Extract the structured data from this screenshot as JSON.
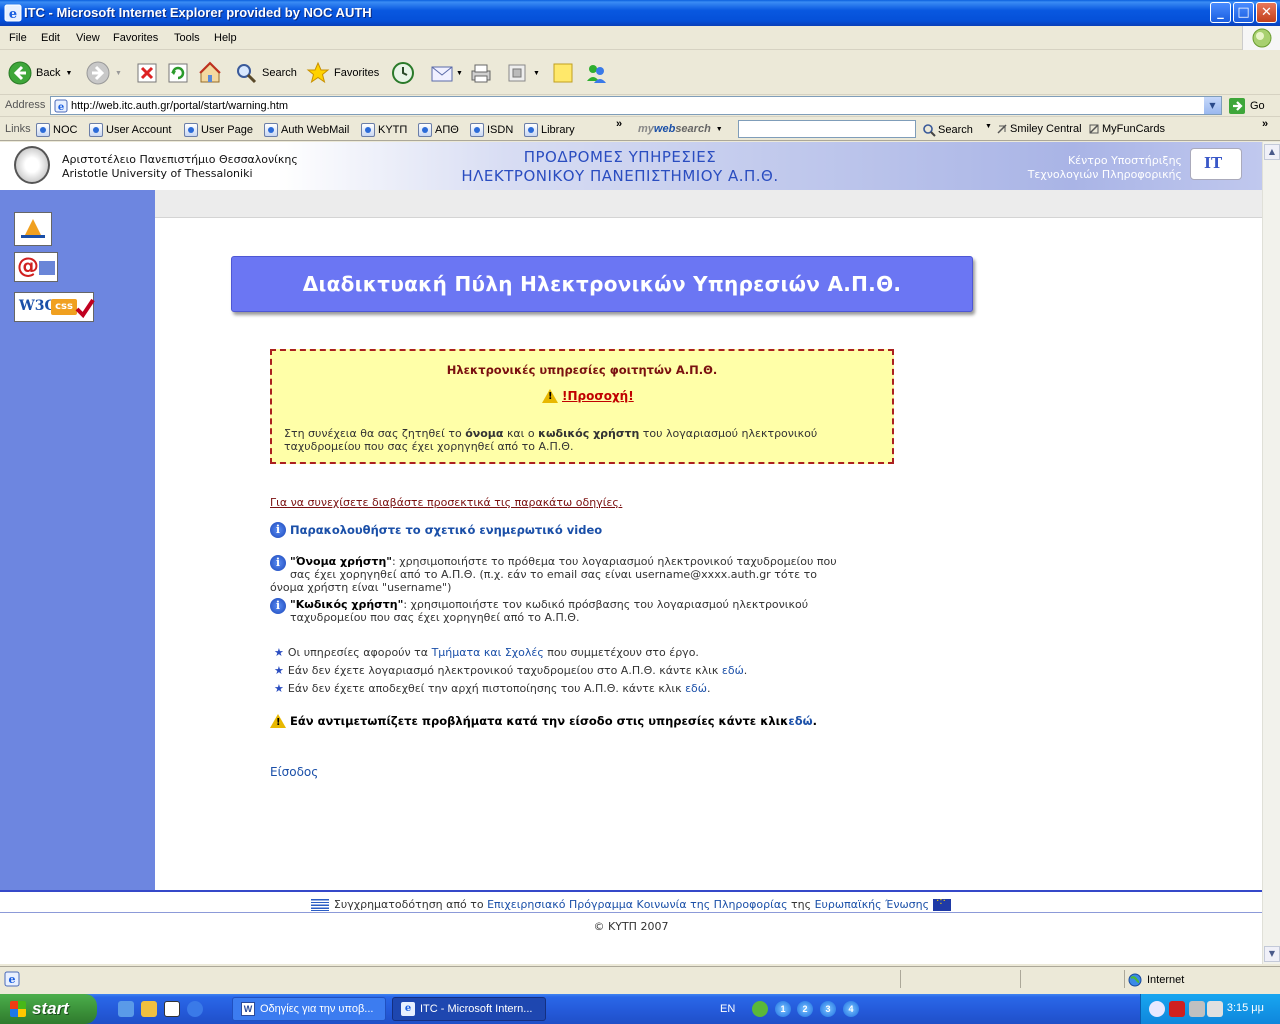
{
  "window": {
    "title": "ITC - Microsoft Internet Explorer provided by NOC  AUTH",
    "controls": {
      "minimize": "_",
      "maximize": "□",
      "close": "✕"
    }
  },
  "menu": [
    "File",
    "Edit",
    "View",
    "Favorites",
    "Tools",
    "Help"
  ],
  "toolbar": {
    "back": "Back",
    "search": "Search",
    "favorites": "Favorites"
  },
  "address": {
    "label": "Address",
    "url": "http://web.itc.auth.gr/portal/start/warning.htm",
    "go": "Go"
  },
  "links": {
    "label": "Links",
    "items": [
      "NOC",
      "User Account",
      "User Page",
      "Auth WebMail",
      "ΚΥΤΠ",
      "ΑΠΘ",
      "ISDN",
      "Library"
    ],
    "chevron": "»",
    "mywebsearch_my": "my",
    "mywebsearch_web": "web",
    "mywebsearch_search": "search",
    "search_value": "",
    "search_button": "Search",
    "smiley": "Smiley Central",
    "myfuncards": "MyFunCards"
  },
  "header": {
    "univ_gr": "Αριστοτέλειο Πανεπιστήμιο Θεσσαλονίκης",
    "univ_en": "Aristotle University of Thessaloniki",
    "title_line1": "ΠΡΟΔΡΟΜΕΣ ΥΠΗΡΕΣΙΕΣ",
    "title_line2": "ΗΛΕΚΤΡΟΝΙΚΟΥ ΠΑΝΕΠΙΣΤΗΜΙΟΥ Α.Π.Θ.",
    "itc_line1": "Κέντρο Υποστήριξης",
    "itc_line2": "Τεχνολογιών Πληροφορικής"
  },
  "sidebar": {
    "badge_css": "css",
    "badge_w3c": "W3C"
  },
  "banner": "Διαδικτυακή Πύλη Ηλεκτρονικών Υπηρεσιών Α.Π.Θ.",
  "warning": {
    "title": "Ηλεκτρονικές υπηρεσίες φοιτητών Α.Π.Θ.",
    "attention": "!Προσοχή!",
    "text_a": "Στη συνέχεια θα σας ζητηθεί το ",
    "text_b": "όνομα",
    "text_c": " και ο ",
    "text_d": "κωδικός χρήστη",
    "text_e": " του λογαριασμού ηλεκτρονικού ταχυδρομείου που σας έχει χορηγηθεί από το Α.Π.Θ."
  },
  "content": {
    "instructions": "Για να συνεχίσετε διαβάστε προσεκτικά τις παρακάτω οδηγίες.",
    "video": "Παρακολουθήστε το σχετικό ενημερωτικό video",
    "username_label": "\"Όνομα χρήστη\"",
    "username_text": ": χρησιμοποιήστε το πρόθεμα του λογαριασμού ηλεκτρονικού ταχυδρομείου που σας έχει χορηγηθεί από το Α.Π.Θ. (π.χ. εάν το email σας είναι username@xxxx.auth.gr τότε το όνομα χρήστη είναι \"username\")",
    "password_label": "\"Κωδικός χρήστη\"",
    "password_text": ": χρησιμοποιήστε τον κωδικό πρόσβασης του λογαριασμού ηλεκτρονικού ταχυδρομείου που σας έχει χορηγηθεί από το Α.Π.Θ.",
    "bullet1_a": "Οι υπηρεσίες αφορούν τα ",
    "bullet1_link": "Τμήματα και Σχολές",
    "bullet1_b": " που συμμετέχουν στο έργο.",
    "bullet2_a": "Εάν δεν έχετε λογαριασμό ηλεκτρονικού ταχυδρομείου στο Α.Π.Θ. κάντε κλικ ",
    "bullet2_link": "εδώ",
    "bullet2_b": ".",
    "bullet3_a": "Εάν δεν έχετε αποδεχθεί την αρχή πιστοποίησης του Α.Π.Θ. κάντε κλικ ",
    "bullet3_link": "εδώ",
    "bullet3_b": ".",
    "problems_a": "Εάν αντιμετωπίζετε προβλήματα κατά την είσοδο στις υπηρεσίες κάντε κλικ ",
    "problems_link": "εδώ",
    "problems_b": ".",
    "login": "Είσοδος"
  },
  "footer": {
    "text_a": "Συγχρηματοδότηση από το ",
    "link1": "Επιχειρησιακό Πρόγραμμα Κοινωνία της Πληροφορίας",
    "text_b": " της ",
    "link2": "Ευρωπαϊκής Ένωσης",
    "copyright": "© ΚΥΤΠ 2007"
  },
  "status": {
    "zone": "Internet"
  },
  "taskbar": {
    "start": "start",
    "task1": "Οδηγίες για την υποβ...",
    "task2": "ITC - Microsoft Intern...",
    "lang": "EN",
    "clock": "3:15 μμ",
    "desktops": [
      "1",
      "2",
      "3",
      "4"
    ]
  }
}
